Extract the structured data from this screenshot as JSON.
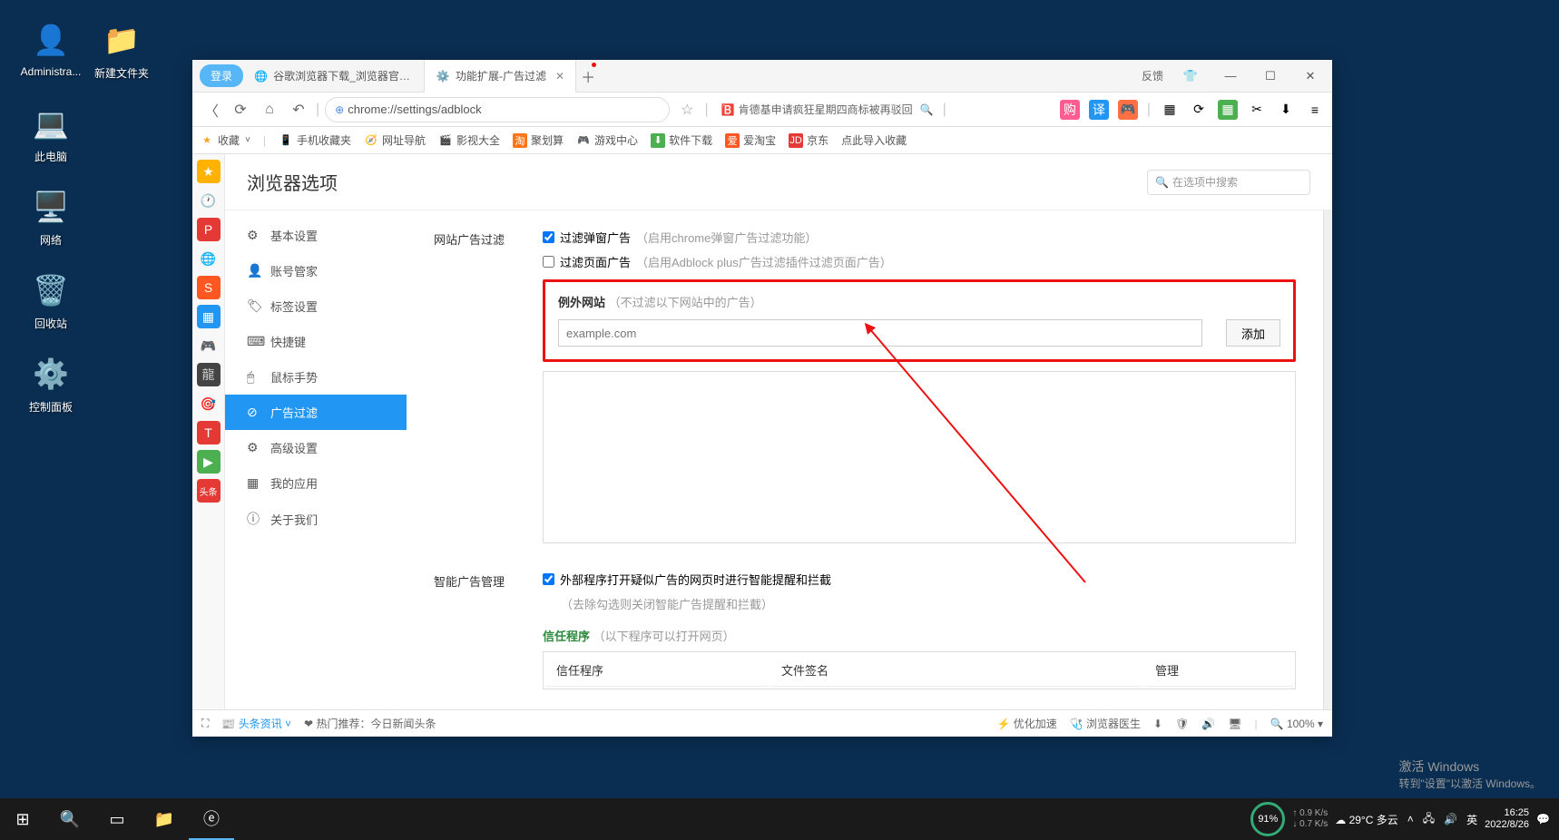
{
  "desktop": {
    "icons": [
      {
        "label": "Administra...",
        "glyph": "👤"
      },
      {
        "label": "新建文件夹",
        "glyph": "📁"
      },
      {
        "label": "此电脑",
        "glyph": "💻"
      },
      {
        "label": "网络",
        "glyph": "🖥️"
      },
      {
        "label": "回收站",
        "glyph": "🗑️"
      },
      {
        "label": "控制面板",
        "glyph": "⚙️"
      }
    ]
  },
  "browser": {
    "login_btn": "登录",
    "tabs": [
      {
        "title": "谷歌浏览器下载_浏览器官网入",
        "active": false
      },
      {
        "title": "功能扩展-广告过滤",
        "active": true
      }
    ],
    "feedback": "反馈",
    "url": "chrome://settings/adblock",
    "search_hint": "肯德基申请疯狂星期四商标被再驳回",
    "bookmarks": {
      "fav": "收藏",
      "items": [
        "手机收藏夹",
        "网址导航",
        "影视大全",
        "聚划算",
        "游戏中心",
        "软件下载",
        "爱淘宝",
        "京东",
        "点此导入收藏"
      ]
    }
  },
  "settings": {
    "title": "浏览器选项",
    "search_placeholder": "在选项中搜索",
    "nav": [
      "基本设置",
      "账号管家",
      "标签设置",
      "快捷键",
      "鼠标手势",
      "广告过滤",
      "高级设置",
      "我的应用",
      "关于我们"
    ],
    "section1": {
      "label": "网站广告过滤",
      "check1": "过滤弹窗广告",
      "check1_hint": "（启用chrome弹窗广告过滤功能）",
      "check2": "过滤页面广告",
      "check2_hint": "（启用Adblock plus广告过滤插件过滤页面广告）",
      "except_label": "例外网站",
      "except_hint": "（不过滤以下网站中的广告）",
      "input_placeholder": "example.com",
      "add_btn": "添加"
    },
    "section2": {
      "label": "智能广告管理",
      "check1": "外部程序打开疑似广告的网页时进行智能提醒和拦截",
      "hint": "（去除勾选则关闭智能广告提醒和拦截）",
      "trust_label": "信任程序",
      "trust_hint": "（以下程序可以打开网页）",
      "th1": "信任程序",
      "th2": "文件签名",
      "th3": "管理"
    }
  },
  "statusbar": {
    "news": "头条资讯",
    "hot": "热门推荐：今日新闻头条",
    "optimize": "优化加速",
    "doctor": "浏览器医生",
    "zoom": "100%"
  },
  "taskbar": {
    "meter": "91%",
    "speed_up": "↑ 0.9 K/s",
    "speed_down": "↓ 0.7 K/s",
    "weather": "29°C 多云",
    "ime": "英",
    "time": "16:25",
    "date": "2022/8/26"
  },
  "activate": {
    "line1": "激活 Windows",
    "line2": "转到\"设置\"以激活 Windows。"
  }
}
